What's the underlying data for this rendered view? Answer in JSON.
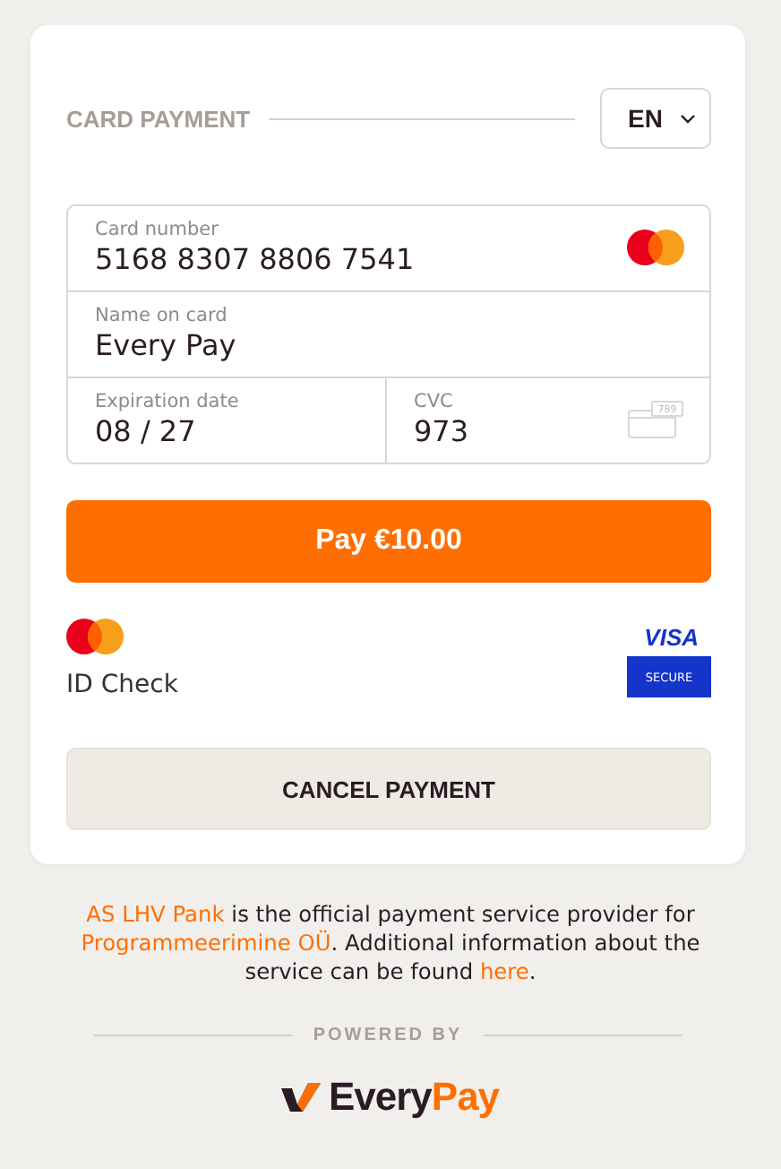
{
  "header": {
    "title": "CARD PAYMENT",
    "language": "EN"
  },
  "fields": [
    {
      "label": "Card number",
      "value": "5168 8307 8806 7541",
      "kind": "card"
    },
    {
      "label": "Name on card",
      "value": "Every Pay",
      "kind": "plain"
    },
    {
      "label": "Expiration date",
      "value": "08 / 27",
      "kind": "half"
    },
    {
      "label": "CVC",
      "value": "973",
      "kind": "cvc",
      "hint": "789"
    }
  ],
  "pay_button": "Pay €10.00",
  "badges": {
    "mastercard": "ID Check",
    "visa": "VISA",
    "visa_secure": "SECURE"
  },
  "cancel_button": "CANCEL PAYMENT",
  "footer": {
    "parts": [
      {
        "text": "AS LHV Pank",
        "kind": "link"
      },
      {
        "text": " is the official payment service provider for ",
        "kind": "text"
      },
      {
        "text": "Programmeerimine OÜ",
        "kind": "link"
      },
      {
        "text": ". Additional information about the service can be found ",
        "kind": "text"
      },
      {
        "text": "here",
        "kind": "link"
      },
      {
        "text": ".",
        "kind": "text"
      }
    ]
  },
  "powered_by": "POWERED BY",
  "logo": [
    "Every",
    "Pay"
  ]
}
